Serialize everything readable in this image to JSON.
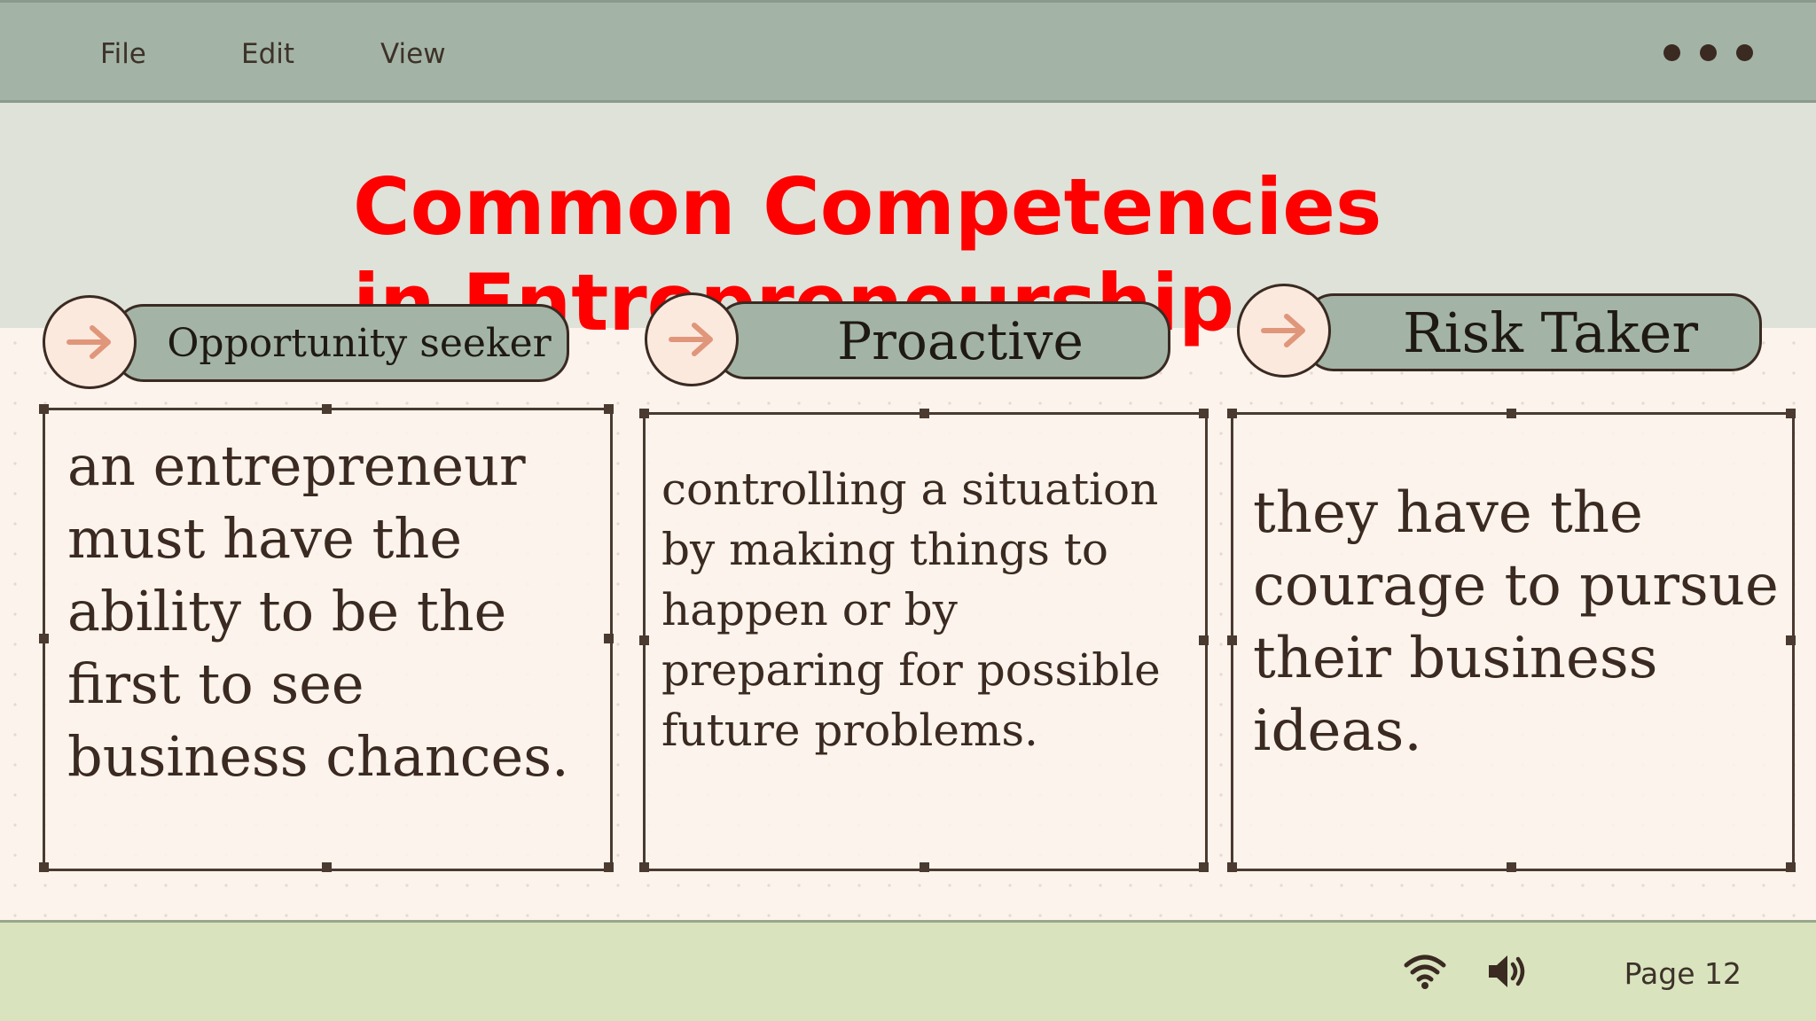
{
  "menu": {
    "file": "File",
    "edit": "Edit",
    "view": "View"
  },
  "slide": {
    "title": "Common Competencies in Entrepreneurship",
    "cards": [
      {
        "label": "Opportunity seeker",
        "text": "an entrepreneur must have the ability to be the first to see business chances."
      },
      {
        "label": "Proactive",
        "text": "controlling a situation by making things to  happen or by preparing for possible future problems."
      },
      {
        "label": "Risk Taker",
        "text": "they have the courage to pursue their business ideas."
      }
    ]
  },
  "status": {
    "page": "Page 12"
  },
  "colors": {
    "title": "#ff0000",
    "topbar": "#a3b4a6",
    "footer": "#d9e4bf",
    "arrow": "#e0967a"
  },
  "icons": [
    "more-options-icon",
    "arrow-right-icon",
    "wifi-icon",
    "volume-icon"
  ]
}
